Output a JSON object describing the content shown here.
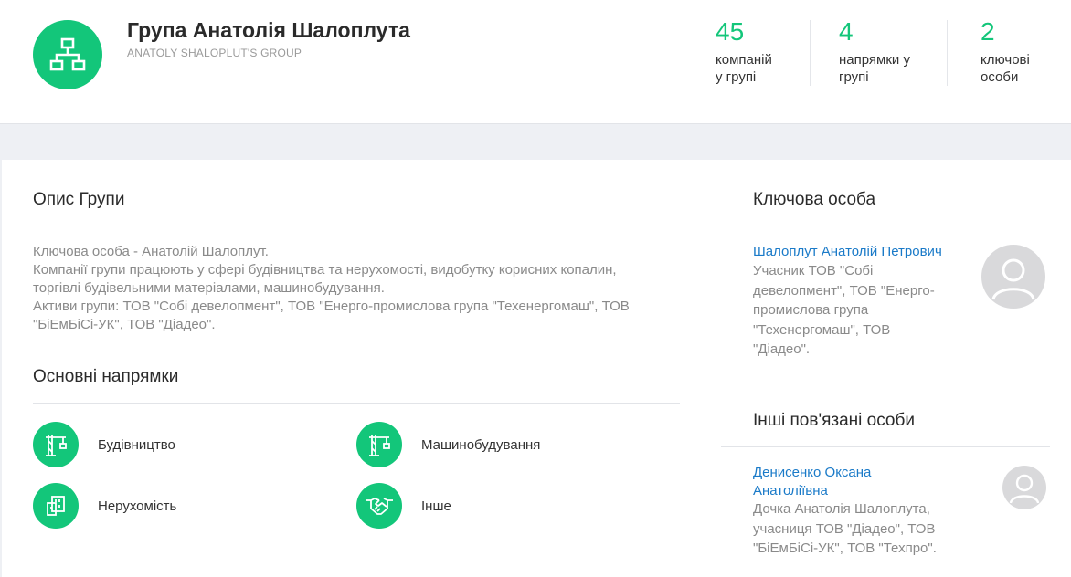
{
  "header": {
    "title": "Група Анатолія Шалоплута",
    "subtitle": "ANATOLY SHALOPLUT'S GROUP",
    "icon": "hierarchy-icon",
    "stats": [
      {
        "value": "45",
        "line1": "компаній",
        "line2": "у групі"
      },
      {
        "value": "4",
        "line1": "напрямки у",
        "line2": "групі"
      },
      {
        "value": "2",
        "line1": "ключові",
        "line2": "особи"
      }
    ]
  },
  "description": {
    "title": "Опис Групи",
    "lines": [
      "Ключова особа - Анатолій Шалоплут.",
      "Компанії групи працюють у сфері будівництва та нерухомості, видобутку корисних копалин,",
      "торгівлі будівельними матеріалами, машинобудування.",
      "Активи групи: ТОВ \"Собі девелопмент\", ТОВ \"Енерго-промислова група \"Техенергомаш\", ТОВ",
      "\"БіЕмБіСі-УК\", ТОВ \"Діадео\"."
    ]
  },
  "directions": {
    "title": "Основні напрямки",
    "items": [
      {
        "label": "Будівництво",
        "icon": "crane-icon"
      },
      {
        "label": "Машинобудування",
        "icon": "crane-icon"
      },
      {
        "label": "Нерухомість",
        "icon": "building-icon"
      },
      {
        "label": "Інше",
        "icon": "handshake-icon"
      }
    ]
  },
  "key_person": {
    "title": "Ключова особа",
    "name": "Шалоплут Анатолій Петрович",
    "desc_lines": [
      "Учасник ТОВ \"Собі",
      "девелопмент\", ТОВ \"Енерго-",
      "промислова група",
      "\"Техенергомаш\", ТОВ",
      "\"Діадео\"."
    ]
  },
  "related": {
    "title": "Інші пов'язані особи",
    "name_lines": [
      "Денисенко Оксана",
      "Анатоліївна"
    ],
    "desc_lines": [
      "Дочка Анатолія Шалоплута,",
      "учасниця ТОВ \"Діадео\", ТОВ",
      "\"БіЕмБіСі-УК\", ТОВ \"Техпро\"."
    ]
  },
  "colors": {
    "accent": "#13c67a",
    "link": "#1a7ac8",
    "muted": "#8a8a8a"
  }
}
